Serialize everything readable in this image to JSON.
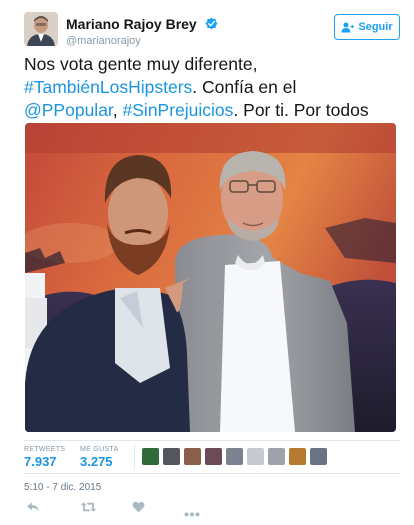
{
  "author": {
    "name": "Mariano Rajoy Brey",
    "handle": "@marianorajoy"
  },
  "follow_button": {
    "label": "Seguir"
  },
  "tweet": {
    "line1": "Nos vota gente muy diferente,",
    "hashtag1": "#TambiénLosHipsters",
    "text2": ". Confía en el",
    "mention": "@PPopular",
    "sep": ", ",
    "hashtag2": "#SinPrejuicios",
    "text3": ". Por ti. Por todos"
  },
  "stats": {
    "retweets_label": "RETWEETS",
    "retweets_value": "7.937",
    "likes_label": "ME GUSTA",
    "likes_value": "3.275"
  },
  "timestamp": "5:10 - 7 dic. 2015",
  "colors": {
    "accent": "#1da1f2",
    "link": "#1b95e0",
    "muted": "#8899a6",
    "like": "#aab8c2"
  },
  "icons": [
    "verified-icon",
    "follow-person-icon",
    "reply-icon",
    "retweet-icon",
    "heart-icon",
    "more-icon"
  ]
}
